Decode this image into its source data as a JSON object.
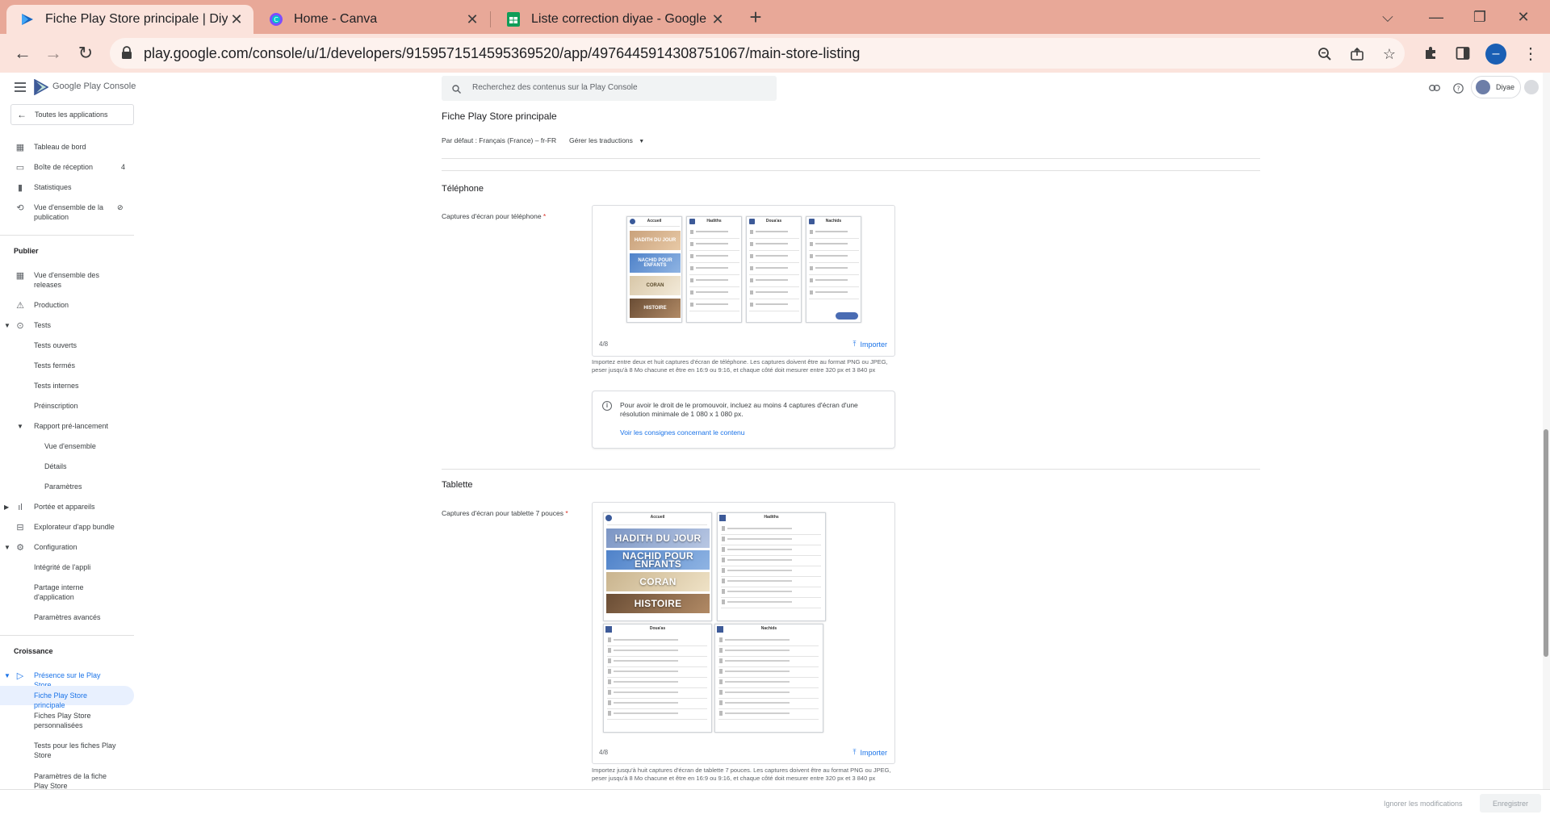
{
  "browser": {
    "tabs": [
      {
        "title": "Fiche Play Store principale | Diyae",
        "active": true
      },
      {
        "title": "Home - Canva",
        "active": false
      },
      {
        "title": "Liste correction diyae - Google Sh",
        "active": false
      }
    ],
    "new_tab": "+",
    "url": "play.google.com/console/u/1/developers/9159571514595369520/app/4976445914308751067/main-store-listing",
    "profile_initial": "–"
  },
  "console": {
    "brand": "Google Play Console",
    "search_placeholder": "Recherchez des contenus sur la Play Console",
    "account_name": "Diyae"
  },
  "sidebar": {
    "all_apps": "Toutes les applications",
    "items_top": [
      {
        "label": "Tableau de bord",
        "icon": "dashboard-icon"
      },
      {
        "label": "Boîte de réception",
        "icon": "inbox-icon",
        "badge": "4"
      },
      {
        "label": "Statistiques",
        "icon": "bar-chart-icon"
      },
      {
        "label": "Vue d'ensemble de la publication",
        "icon": "publishing-icon"
      }
    ],
    "publish_heading": "Publier",
    "publish_items": {
      "releases_overview": "Vue d'ensemble des releases",
      "production": "Production",
      "tests": "Tests",
      "open_tests": "Tests ouverts",
      "closed_tests": "Tests fermés",
      "internal_tests": "Tests internes",
      "preregistration": "Préinscription",
      "prelaunch_report": "Rapport pré-lancement",
      "overview": "Vue d'ensemble",
      "details": "Détails",
      "settings": "Paramètres",
      "reach_devices": "Portée et appareils",
      "bundle_explorer": "Explorateur d'app bundle",
      "configuration": "Configuration",
      "app_integrity": "Intégrité de l'appli",
      "internal_sharing": "Partage interne d'application",
      "advanced_settings": "Paramètres avancés"
    },
    "growth_heading": "Croissance",
    "growth_items": {
      "store_presence": "Présence sur le Play Store",
      "main_listing": "Fiche Play Store principale",
      "custom_listings": "Fiches Play Store personnalisées",
      "listing_tests": "Tests pour les fiches Play Store",
      "listing_settings": "Paramètres de la fiche Play Store"
    }
  },
  "main": {
    "title": "Fiche Play Store principale",
    "default_language": "Par défaut : Français (France) – fr-FR",
    "manage_translations": "Gérer les traductions",
    "phone": {
      "section_title": "Téléphone",
      "label": "Captures d'écran pour téléphone",
      "required_mark": "*",
      "counter": "4/8",
      "import_label": "Importer",
      "help": "Importez entre deux et huit captures d'écran de téléphone. Les captures doivent être au format PNG ou JPEG, peser jusqu'à 8 Mo chacune et être en 16:9 ou 9:16, et chaque côté doit mesurer entre 320 px et 3 840 px",
      "notice_text": "Pour avoir le droit de le promouvoir, incluez au moins 4 captures d'écran d'une résolution minimale de 1 080 x 1 080 px.",
      "notice_link": "Voir les consignes concernant le contenu",
      "screens": [
        {
          "title": "Accueil",
          "banners": [
            "HADITH DU JOUR",
            "NACHID POUR ENFANTS",
            "CORAN",
            "HISTOIRE"
          ]
        },
        {
          "title": "Hadiths"
        },
        {
          "title": "Doua'as"
        },
        {
          "title": "Nachids"
        }
      ]
    },
    "tablet": {
      "section_title": "Tablette",
      "label": "Captures d'écran pour tablette 7 pouces",
      "required_mark": "*",
      "counter": "4/8",
      "import_label": "Importer",
      "help": "Importez jusqu'à huit captures d'écran de tablette 7 pouces. Les captures doivent être au format PNG ou JPEG, peser jusqu'à 8 Mo chacune et être en 16:9 ou 9:16, et chaque côté doit mesurer entre 320 px et 3 840 px",
      "screens": [
        {
          "title": "Accueil",
          "banners": [
            "HADITH DU JOUR",
            "NACHID POUR ENFANTS",
            "CORAN",
            "HISTOIRE"
          ]
        },
        {
          "title": "Hadiths"
        },
        {
          "title": "Doua'as"
        },
        {
          "title": "Nachids"
        }
      ]
    }
  },
  "footer": {
    "ignore": "Ignorer les modifications",
    "save": "Enregistrer"
  },
  "colors": {
    "accent": "#1a73e8",
    "tab_strip": "#e8a898",
    "toolbar": "#fbe3dc",
    "selected_nav_bg": "#e8f0fe"
  }
}
